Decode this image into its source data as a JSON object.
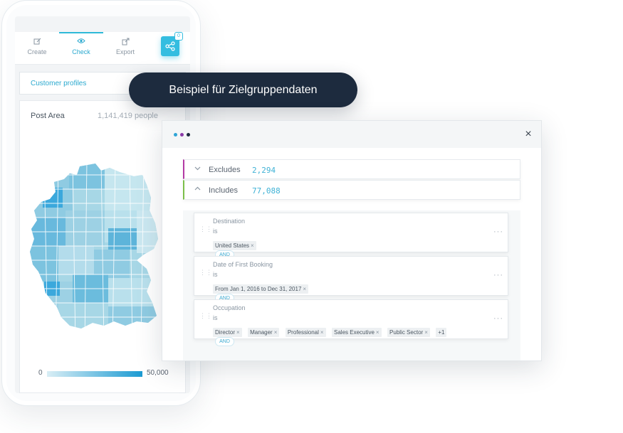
{
  "phone": {
    "tabs": [
      {
        "label": "Create",
        "icon": "edit-icon"
      },
      {
        "label": "Check",
        "icon": "eye-icon"
      },
      {
        "label": "Export",
        "icon": "export-icon"
      }
    ],
    "share_badge": "0",
    "profile_select": "Customer profiles",
    "card": {
      "label": "Post Area",
      "count": "1,141,419 people",
      "legend_min": "0",
      "legend_max": "50,000"
    }
  },
  "tooltip": "Beispiel für Zielgruppendaten",
  "dialog": {
    "window_dots": [
      "#2ea4d6",
      "#8a3aa8",
      "#1d2b3e"
    ],
    "close_icon": "×",
    "excludes": {
      "label": "Excludes",
      "count": "2,294"
    },
    "includes": {
      "label": "Includes",
      "count": "77,088"
    },
    "rules": [
      {
        "field": "Destination",
        "operator": "is",
        "chips": [
          "United States"
        ]
      },
      {
        "field": "Date of First Booking",
        "operator": "is",
        "chips": [
          "From Jan 1, 2016 to Dec 31, 2017"
        ]
      },
      {
        "field": "Occupation",
        "operator": "is",
        "chips": [
          "Director",
          "Manager",
          "Professional",
          "Sales Executive",
          "Public Sector"
        ],
        "extra": "+1"
      }
    ],
    "connector": "AND"
  },
  "colors": {
    "accent": "#2eb9d8",
    "tooltip_bg": "#1d2b3e",
    "excludes_bar": "#b33aa4",
    "includes_bar": "#7cbf4a"
  }
}
